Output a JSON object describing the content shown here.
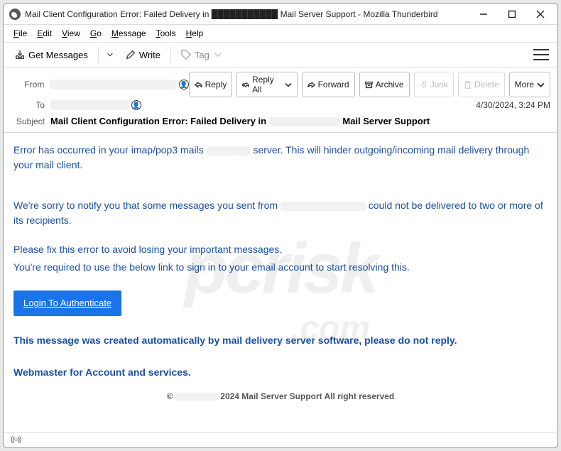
{
  "window": {
    "title": "Mail Client Configuration Error: Failed Delivery in ███████████  Mail Server Support - Mozilla Thunderbird"
  },
  "menu": {
    "file": "File",
    "edit": "Edit",
    "view": "View",
    "go": "Go",
    "message": "Message",
    "tools": "Tools",
    "help": "Help"
  },
  "toolbar": {
    "get_messages": "Get Messages",
    "write": "Write",
    "tag": "Tag"
  },
  "header": {
    "from_label": "From",
    "to_label": "To",
    "subject_label": "Subject",
    "subject_pre": "Mail Client Configuration Error: Failed Delivery in",
    "subject_post": "Mail Server Support",
    "date": "4/30/2024, 3:24 PM",
    "actions": {
      "reply": "Reply",
      "reply_all": "Reply All",
      "forward": "Forward",
      "archive": "Archive",
      "junk": "Junk",
      "delete": "Delete",
      "more": "More"
    }
  },
  "body": {
    "p1a": "Error has occurred in your imap/pop3 mails ",
    "p1b": " server. This will hinder outgoing/incoming mail delivery through your mail client.",
    "p2a": "We're sorry to notify you that some messages you sent from ",
    "p2b": " could not be delivered to two or more of its recipients.",
    "p3": "Please fix this error to avoid losing your important messages.",
    "p4": "You're required to use the below link to sign in to your email account to start resolving this.",
    "login": "Login To Authenticate",
    "f1": "This message was created automatically by mail delivery server software, please do not reply.",
    "f2": "Webmaster for Account and services.",
    "copy_pre": "© ",
    "copy_post": " 2024 Mail Server Support All right reserved"
  },
  "status": {
    "indicator": "((○))"
  }
}
